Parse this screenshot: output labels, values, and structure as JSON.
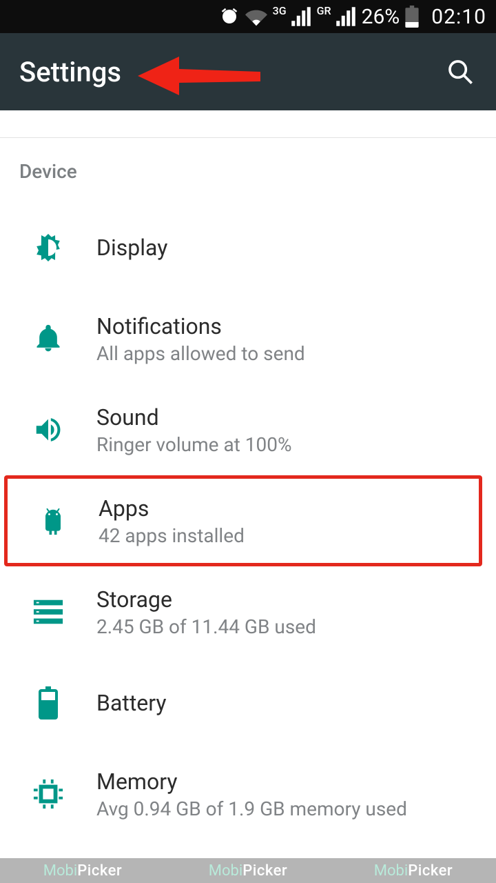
{
  "status_bar": {
    "net_label_1": "3G",
    "net_label_2": "GR",
    "battery_pct": "26%",
    "time": "02:10"
  },
  "app_bar": {
    "title": "Settings"
  },
  "section": {
    "header": "Device"
  },
  "items": {
    "display": {
      "title": "Display"
    },
    "notifications": {
      "title": "Notifications",
      "sub": "All apps allowed to send"
    },
    "sound": {
      "title": "Sound",
      "sub": "Ringer volume at 100%"
    },
    "apps": {
      "title": "Apps",
      "sub": "42 apps installed"
    },
    "storage": {
      "title": "Storage",
      "sub": "2.45 GB of 11.44 GB used"
    },
    "battery": {
      "title": "Battery"
    },
    "memory": {
      "title": "Memory",
      "sub": "Avg 0.94 GB of 1.9 GB memory used"
    }
  },
  "colors": {
    "teal": "#009788",
    "highlight": "#e3281d",
    "appbar": "#29353a"
  },
  "watermark": {
    "brand_a": "Mobi",
    "brand_b": "Picker"
  }
}
